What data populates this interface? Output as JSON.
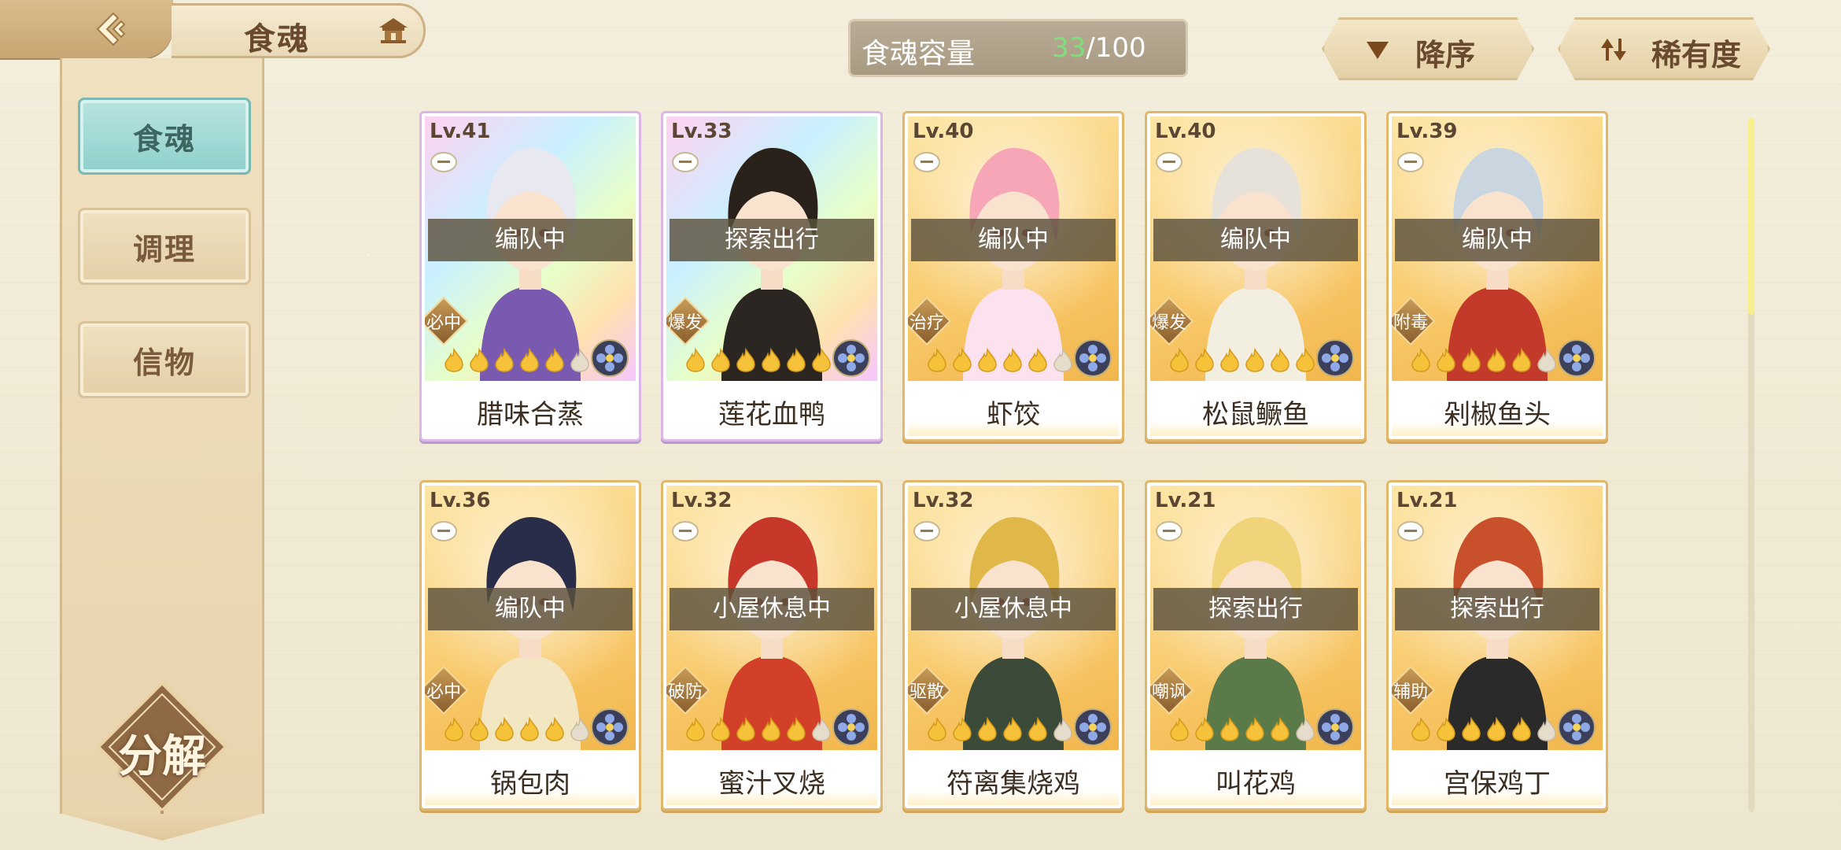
{
  "header": {
    "title": "食魂",
    "back_icon": "back-arrow-icon",
    "home_icon": "house-icon"
  },
  "sidebar": {
    "tabs": [
      {
        "label": "食魂",
        "active": true
      },
      {
        "label": "调理",
        "active": false
      },
      {
        "label": "信物",
        "active": false
      }
    ],
    "decompose_label": "分解"
  },
  "capacity": {
    "label": "食魂容量",
    "current": "33",
    "max": "/100"
  },
  "sort": {
    "order_label": "降序",
    "rarity_label": "稀有度"
  },
  "cards": [
    {
      "level": "Lv.41",
      "status": "编队中",
      "role": "必中",
      "stars": 5,
      "name": "腊味合蒸",
      "frame": "rainbow"
    },
    {
      "level": "Lv.33",
      "status": "探索出行",
      "role": "爆发",
      "stars": 6,
      "name": "莲花血鸭",
      "frame": "rainbow"
    },
    {
      "level": "Lv.40",
      "status": "编队中",
      "role": "治疗",
      "stars": 5,
      "name": "虾饺",
      "frame": "gold"
    },
    {
      "level": "Lv.40",
      "status": "编队中",
      "role": "爆发",
      "stars": 6,
      "name": "松鼠鳜鱼",
      "frame": "gold"
    },
    {
      "level": "Lv.39",
      "status": "编队中",
      "role": "附毒",
      "stars": 5,
      "name": "剁椒鱼头",
      "frame": "gold"
    },
    {
      "level": "Lv.36",
      "status": "编队中",
      "role": "必中",
      "stars": 5,
      "name": "锅包肉",
      "frame": "gold"
    },
    {
      "level": "Lv.32",
      "status": "小屋休息中",
      "role": "破防",
      "stars": 5,
      "name": "蜜汁叉烧",
      "frame": "gold"
    },
    {
      "level": "Lv.32",
      "status": "小屋休息中",
      "role": "驱散",
      "stars": 5,
      "name": "符离集烧鸡",
      "frame": "gold"
    },
    {
      "level": "Lv.21",
      "status": "探索出行",
      "role": "嘲讽",
      "stars": 5,
      "name": "叫花鸡",
      "frame": "gold"
    },
    {
      "level": "Lv.21",
      "status": "探索出行",
      "role": "辅助",
      "stars": 5,
      "name": "宫保鸡丁",
      "frame": "gold"
    }
  ],
  "colors": {
    "accent_teal": "#8fd0cb",
    "gold_frame": "#e1b86a",
    "capacity_current": "#7ee07a"
  }
}
